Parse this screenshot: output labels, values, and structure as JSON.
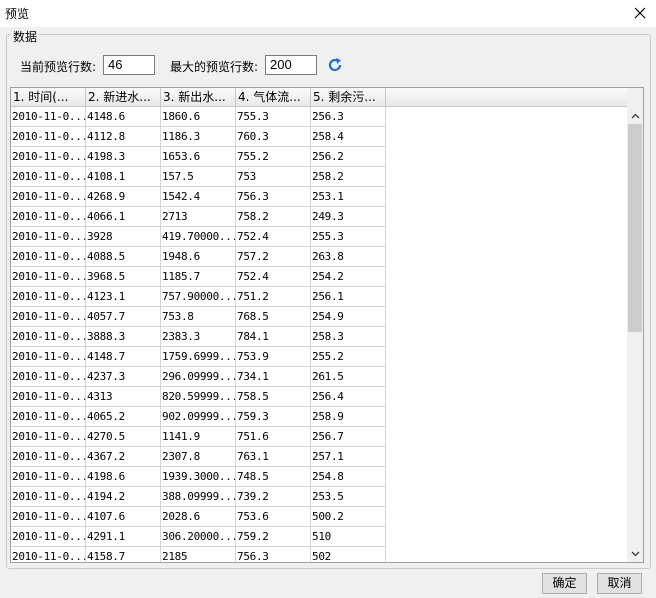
{
  "window": {
    "title": "预览"
  },
  "group": {
    "legend": "数据"
  },
  "preview": {
    "current_label": "当前预览行数:",
    "current_value": "46",
    "max_label": "最大的预览行数:",
    "max_value": "200"
  },
  "table": {
    "columns": [
      "1. 时间(...",
      "2. 新进水...",
      "3. 新出水...",
      "4. 气体流...",
      "5. 剩余污..."
    ],
    "rows": [
      [
        "2010-11-0...",
        "4148.6",
        "1860.6",
        "755.3",
        "256.3"
      ],
      [
        "2010-11-0...",
        "4112.8",
        "1186.3",
        "760.3",
        "258.4"
      ],
      [
        "2010-11-0...",
        "4198.3",
        "1653.6",
        "755.2",
        "256.2"
      ],
      [
        "2010-11-0...",
        "4108.1",
        "157.5",
        "753",
        "258.2"
      ],
      [
        "2010-11-0...",
        "4268.9",
        "1542.4",
        "756.3",
        "253.1"
      ],
      [
        "2010-11-0...",
        "4066.1",
        "2713",
        "758.2",
        "249.3"
      ],
      [
        "2010-11-0...",
        "3928",
        "419.70000...",
        "752.4",
        "255.3"
      ],
      [
        "2010-11-0...",
        "4088.5",
        "1948.6",
        "757.2",
        "263.8"
      ],
      [
        "2010-11-0...",
        "3968.5",
        "1185.7",
        "752.4",
        "254.2"
      ],
      [
        "2010-11-0...",
        "4123.1",
        "757.90000...",
        "751.2",
        "256.1"
      ],
      [
        "2010-11-0...",
        "4057.7",
        "753.8",
        "768.5",
        "254.9"
      ],
      [
        "2010-11-0...",
        "3888.3",
        "2383.3",
        "784.1",
        "258.3"
      ],
      [
        "2010-11-0...",
        "4148.7",
        "1759.6999...",
        "753.9",
        "255.2"
      ],
      [
        "2010-11-0...",
        "4237.3",
        "296.09999...",
        "734.1",
        "261.5"
      ],
      [
        "2010-11-0...",
        "4313",
        "820.59999...",
        "758.5",
        "256.4"
      ],
      [
        "2010-11-0...",
        "4065.2",
        "902.09999...",
        "759.3",
        "258.9"
      ],
      [
        "2010-11-0...",
        "4270.5",
        "1141.9",
        "751.6",
        "256.7"
      ],
      [
        "2010-11-0...",
        "4367.2",
        "2307.8",
        "763.1",
        "257.1"
      ],
      [
        "2010-11-0...",
        "4198.6",
        "1939.3000...",
        "748.5",
        "254.8"
      ],
      [
        "2010-11-0...",
        "4194.2",
        "388.09999...",
        "739.2",
        "253.5"
      ],
      [
        "2010-11-0...",
        "4107.6",
        "2028.6",
        "753.6",
        "500.2"
      ],
      [
        "2010-11-0...",
        "4291.1",
        "306.20000...",
        "759.2",
        "510"
      ],
      [
        "2010-11-0...",
        "4158.7",
        "2185",
        "756.3",
        "502"
      ]
    ]
  },
  "buttons": {
    "ok": "确定",
    "cancel": "取消"
  },
  "icons": {
    "close": "close-icon",
    "refresh": "refresh-icon"
  },
  "colors": {
    "accent": "#1e6fd9"
  }
}
